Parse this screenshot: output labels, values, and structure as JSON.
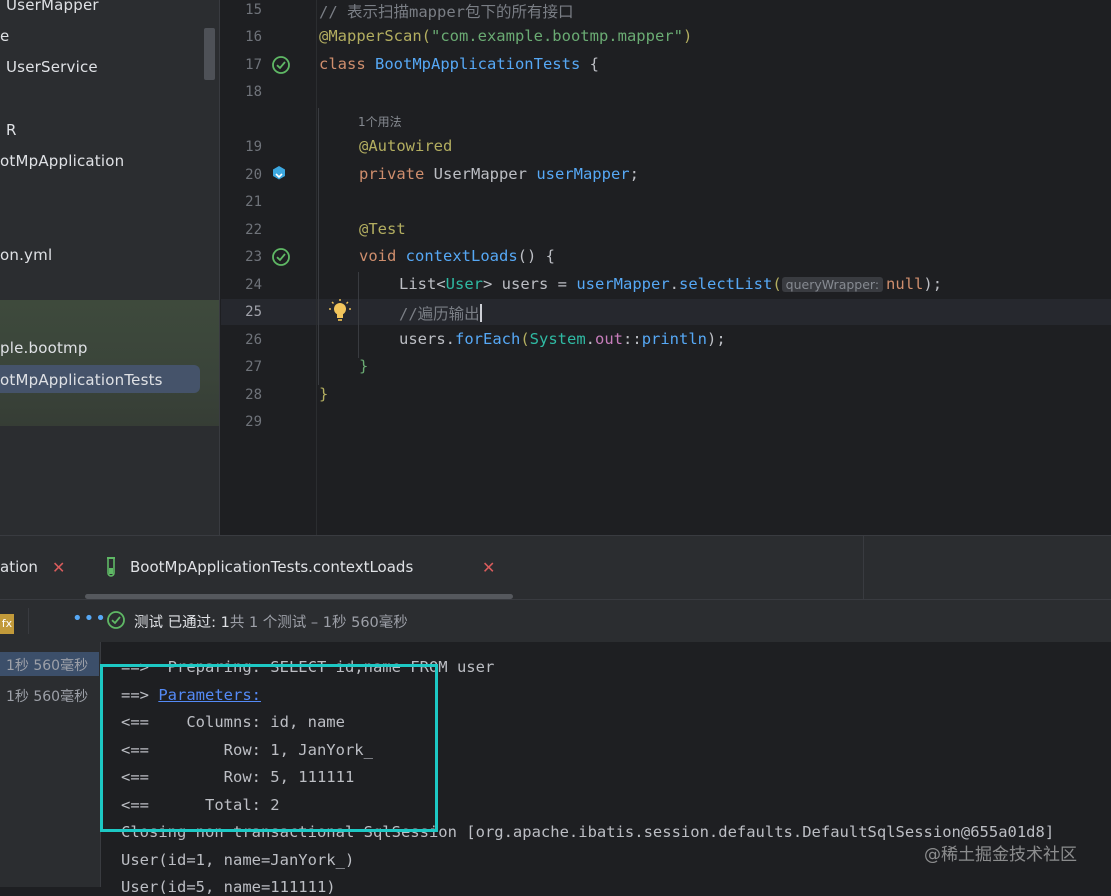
{
  "project_tree": {
    "items": [
      "UserMapper",
      "e",
      "UserService",
      "R",
      "otMpApplication",
      "on.yml",
      "ple.bootmp",
      "otMpApplicationTests"
    ]
  },
  "editor": {
    "line_numbers": [
      "15",
      "16",
      "17",
      "18",
      "19",
      "20",
      "21",
      "22",
      "23",
      "24",
      "25",
      "26",
      "27",
      "28",
      "29"
    ],
    "usage_hint": "1个用法",
    "lines": {
      "l15": "// 表示扫描mapper包下的所有接口",
      "l16_ann": "@MapperScan(",
      "l16_str": "\"com.example.bootmp.mapper\"",
      "l16_end": ")",
      "l17_kw": "class ",
      "l17_cls": "BootMpApplicationTests",
      "l17_end": " {",
      "l19": "@Autowired",
      "l20_kw": "private ",
      "l20_type": "UserMapper ",
      "l20_fld": "userMapper",
      "l20_end": ";",
      "l22": "@Test",
      "l23_kw": "void ",
      "l23_mth": "contextLoads",
      "l23_end": "() {",
      "l24_a": "List<",
      "l24_b": "User",
      "l24_c": "> users = ",
      "l24_d": "userMapper",
      "l24_e": ".",
      "l24_f": "selectList",
      "l24_g": "(",
      "l24_hint": "queryWrapper:",
      "l24_null": "null",
      "l24_end": ");",
      "l25": "//遍历输出",
      "l26_a": "users.",
      "l26_b": "forEach",
      "l26_c": "(",
      "l26_d": "System",
      "l26_e": ".",
      "l26_f": "out",
      "l26_g": "::",
      "l26_h": "println",
      "l26_i": ");",
      "l27": "}",
      "l28": "}"
    }
  },
  "run_tabs": [
    {
      "label": "ation"
    },
    {
      "label": "BootMpApplicationTests.contextLoads"
    }
  ],
  "status": {
    "passed": "测试 已通过: 1",
    "detail": "共 1 个测试 – 1秒 560毫秒"
  },
  "test_tree": {
    "times": [
      "1秒 560毫秒",
      "1秒 560毫秒"
    ]
  },
  "console": {
    "lines": [
      "==>  Preparing: SELECT id,name FROM user",
      "==> ",
      "Parameters:",
      "<==    Columns: id, name",
      "<==        Row: 1, JanYork_",
      "<==        Row: 5, 111111",
      "<==      Total: 2",
      "Closing non transactional SqlSession [org.apache.ibatis.session.defaults.DefaultSqlSession@655a01d8]",
      "User(id=1, name=JanYork_)",
      "User(id=5, name=111111)"
    ]
  },
  "watermark": "@稀土掘金技术社区",
  "colors": {
    "accent": "#1dc8c4",
    "pass_green": "#5fb865",
    "link": "#548af7"
  }
}
